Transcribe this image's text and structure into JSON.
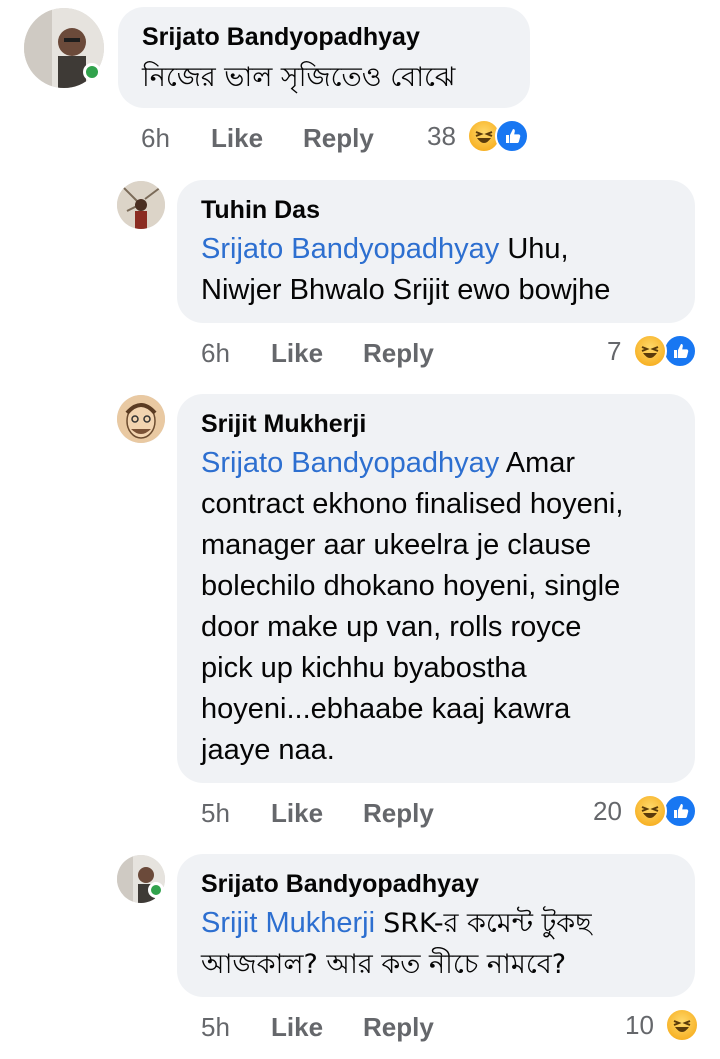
{
  "comments": [
    {
      "author": "Srijato Bandyopadhyay",
      "tag": "",
      "text": "নিজের ভাল সৃজিতেও বোঝে",
      "time": "6h",
      "like": "Like",
      "reply": "Reply",
      "reactions": "38",
      "reaction_icons": [
        "haha-icon",
        "like-icon"
      ],
      "online": true
    },
    {
      "author": "Tuhin Das",
      "tag": "Srijato Bandyopadhyay",
      "text": "Uhu,",
      "text2": "Niwjer Bhwalo Srijit ewo bowjhe",
      "time": "6h",
      "like": "Like",
      "reply": "Reply",
      "reactions": "7",
      "reaction_icons": [
        "haha-icon",
        "like-icon"
      ],
      "online": false
    },
    {
      "author": "Srijit Mukherji",
      "tag": "Srijato Bandyopadhyay",
      "lines": [
        "Amar",
        "contract ekhono finalised hoyeni,",
        "manager aar ukeelra je clause",
        "bolechilo dhokano hoyeni, single",
        "door make up van, rolls royce",
        "pick up kichhu byabostha",
        "hoyeni...ebhaabe kaaj kawra",
        "jaaye naa."
      ],
      "time": "5h",
      "like": "Like",
      "reply": "Reply",
      "reactions": "20",
      "reaction_icons": [
        "haha-icon",
        "like-icon"
      ],
      "online": false
    },
    {
      "author": "Srijato Bandyopadhyay",
      "tag": "Srijit Mukherji",
      "text": "SRK-র কমেন্ট টুকছ",
      "text2": "আজকাল? আর কত নীচে নামবে?",
      "time": "5h",
      "like": "Like",
      "reply": "Reply",
      "reactions": "10",
      "reaction_icons": [
        "haha-icon"
      ],
      "online": true
    }
  ],
  "colors": {
    "bubble": "#f0f2f5",
    "mention": "#2d6fd0",
    "meta": "#65676b",
    "like_blue": "#1877f2",
    "online_green": "#31a24c"
  }
}
